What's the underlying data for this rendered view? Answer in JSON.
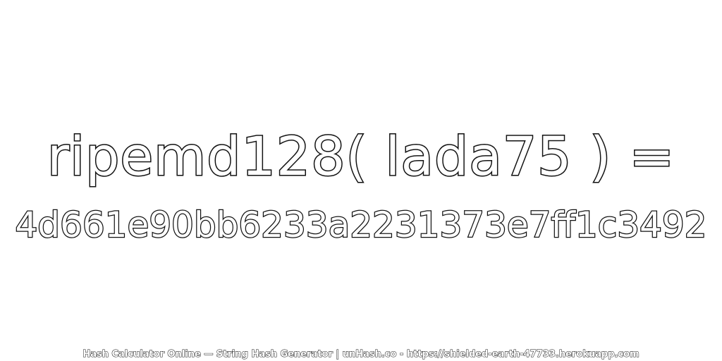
{
  "expression": "ripemd128( lada75 ) =",
  "hash_value": "4d661e90bb6233a2231373e7ff1c3492",
  "footer": "Hash Calculator Online — String Hash Generator | unHash.co - https://shielded-earth-47733.herokuapp.com"
}
